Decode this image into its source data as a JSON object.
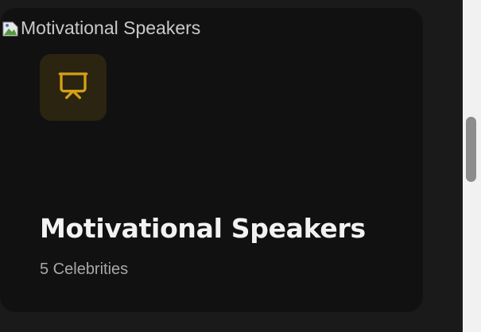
{
  "card": {
    "image_alt": "Motivational Speakers",
    "icon": "presentation-board-icon",
    "title": "Motivational Speakers",
    "count_label": "5 Celebrities"
  },
  "colors": {
    "background": "#1a1a1a",
    "card_background": "#111111",
    "icon_background": "#2b2410",
    "icon_accent": "#d4a017",
    "title": "#f2f2f2",
    "subtitle": "#a8a8a8"
  }
}
